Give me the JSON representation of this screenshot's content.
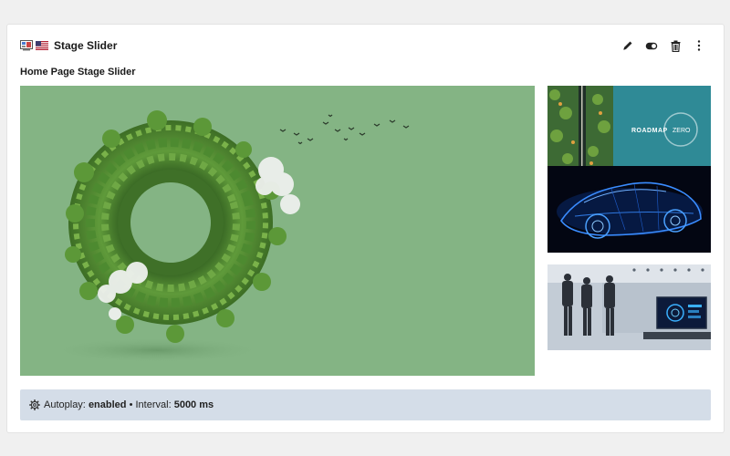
{
  "header": {
    "title": "Stage Slider",
    "content_type_icon": "slider-content-icon",
    "language_flag": "us-flag-icon",
    "actions": [
      {
        "name": "edit-button",
        "icon": "pencil-icon"
      },
      {
        "name": "toggle-visibility-button",
        "icon": "toggle-icon"
      },
      {
        "name": "delete-button",
        "icon": "trash-icon"
      },
      {
        "name": "more-options-button",
        "icon": "kebab-icon"
      }
    ]
  },
  "element": {
    "heading": "Home Page Stage Slider"
  },
  "slides": {
    "main": {
      "image": "green-planet-ring-of-trees-with-birds"
    },
    "thumbnails": [
      {
        "image": "aerial-road-through-forest",
        "text": "ROADMAP",
        "badge": "ZERO"
      },
      {
        "image": "blue-xray-car-wireframe"
      },
      {
        "image": "engineers-in-lab-with-monitor"
      }
    ]
  },
  "settings": {
    "autoplay_label": "Autoplay:",
    "autoplay_value": "enabled",
    "separator": "•",
    "interval_label": "Interval:",
    "interval_value": "5000 ms"
  },
  "colors": {
    "stage_bg": "#84b484",
    "infobar_bg": "#d4dde8"
  }
}
